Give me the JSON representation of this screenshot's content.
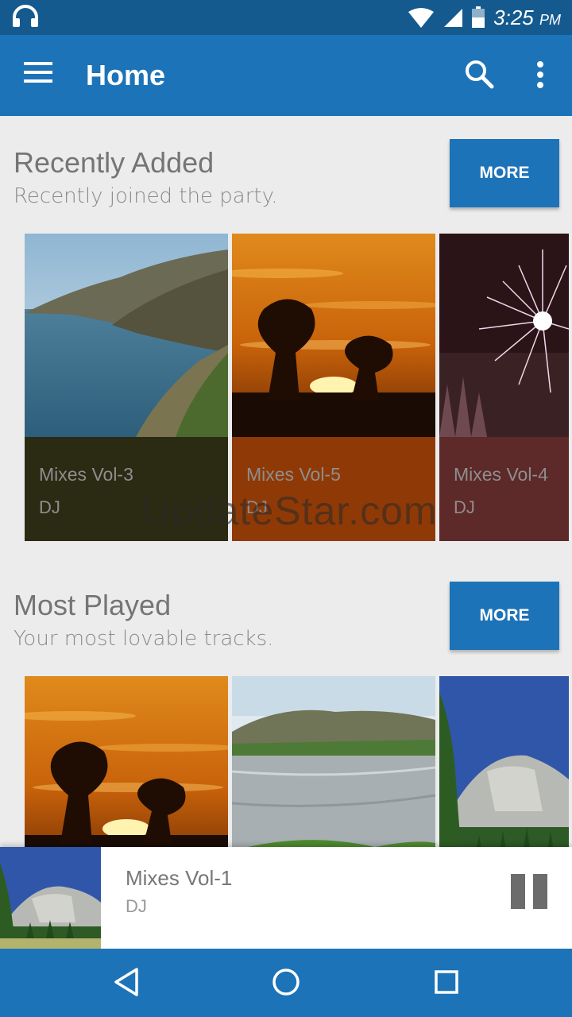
{
  "status_bar": {
    "time": "3:25",
    "ampm": "PM",
    "icons": [
      "headphones-icon",
      "wifi-icon",
      "signal-icon",
      "battery-icon"
    ]
  },
  "app_bar": {
    "title": "Home",
    "icons": [
      "menu-icon",
      "search-icon",
      "overflow-icon"
    ]
  },
  "sections": [
    {
      "title": "Recently Added",
      "subtitle": "Recently joined the party.",
      "more_label": "MORE",
      "albums": [
        {
          "name": "Mixes Vol-3",
          "artist": "DJ",
          "art": "coastline",
          "color": "#2b2a13"
        },
        {
          "name": "Mixes Vol-5",
          "artist": "DJ",
          "art": "sunset",
          "color": "#8f3a06"
        },
        {
          "name": "Mixes Vol-4",
          "artist": "DJ",
          "art": "fireworks",
          "color": "#5e2929"
        }
      ]
    },
    {
      "title": "Most Played",
      "subtitle": "Your most lovable tracks.",
      "more_label": "MORE",
      "albums": [
        {
          "art": "sunset"
        },
        {
          "art": "lake"
        },
        {
          "art": "mountain"
        }
      ]
    }
  ],
  "watermark": "UpdateStar.com",
  "now_playing": {
    "track": "Mixes Vol-1",
    "artist": "DJ",
    "art": "mountain"
  },
  "nav_bar": {
    "icons": [
      "back-icon",
      "home-icon",
      "recents-icon"
    ]
  },
  "colors": {
    "primary": "#1d73b8",
    "status_bar": "#155a8f",
    "background": "#ececec"
  }
}
